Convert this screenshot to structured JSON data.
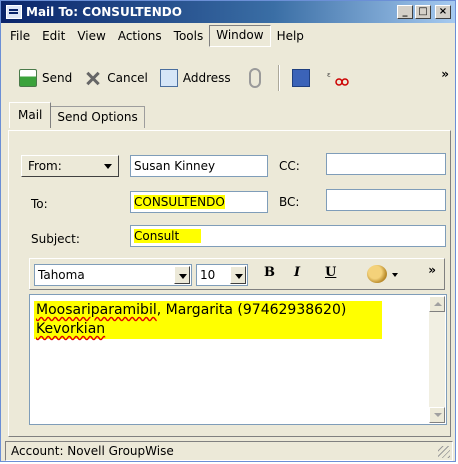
{
  "window": {
    "title": "Mail To: CONSULTENDO",
    "controls": {
      "minimize": "_",
      "maximize": "□",
      "close": "×"
    }
  },
  "menu": [
    "File",
    "Edit",
    "View",
    "Actions",
    "Tools",
    "Window",
    "Help"
  ],
  "menu_active": "Window",
  "toolbar": {
    "send": "Send",
    "cancel": "Cancel",
    "address": "Address",
    "more": "»"
  },
  "tabs": [
    "Mail",
    "Send Options"
  ],
  "tabs_selected": "Mail",
  "form": {
    "from_label": "From:",
    "from_value": "Susan Kinney",
    "cc_label": "CC:",
    "cc_value": "",
    "to_label": "To:",
    "to_value": "CONSULTENDO",
    "bc_label": "BC:",
    "bc_value": "",
    "subject_label": "Subject:",
    "subject_value": "Consult"
  },
  "format": {
    "font": "Tahoma",
    "size": "10",
    "bold": "B",
    "italic": "I",
    "underline": "U",
    "more": "»"
  },
  "message": {
    "line1_misspelled": "Moosariparamibil",
    "line1_rest": ", Margarita (97462938620)",
    "line2": "Kevorkian"
  },
  "status": {
    "account": "Account: Novell GroupWise"
  },
  "icons": {
    "send": "send-icon",
    "cancel": "cancel-icon",
    "address": "address-book-icon",
    "attach": "paperclip-icon",
    "save": "save-icon",
    "spell": "spell-check-icon",
    "palette": "palette-icon"
  },
  "colors": {
    "highlight": "#ffff00",
    "title_bar": "#0a246a"
  }
}
